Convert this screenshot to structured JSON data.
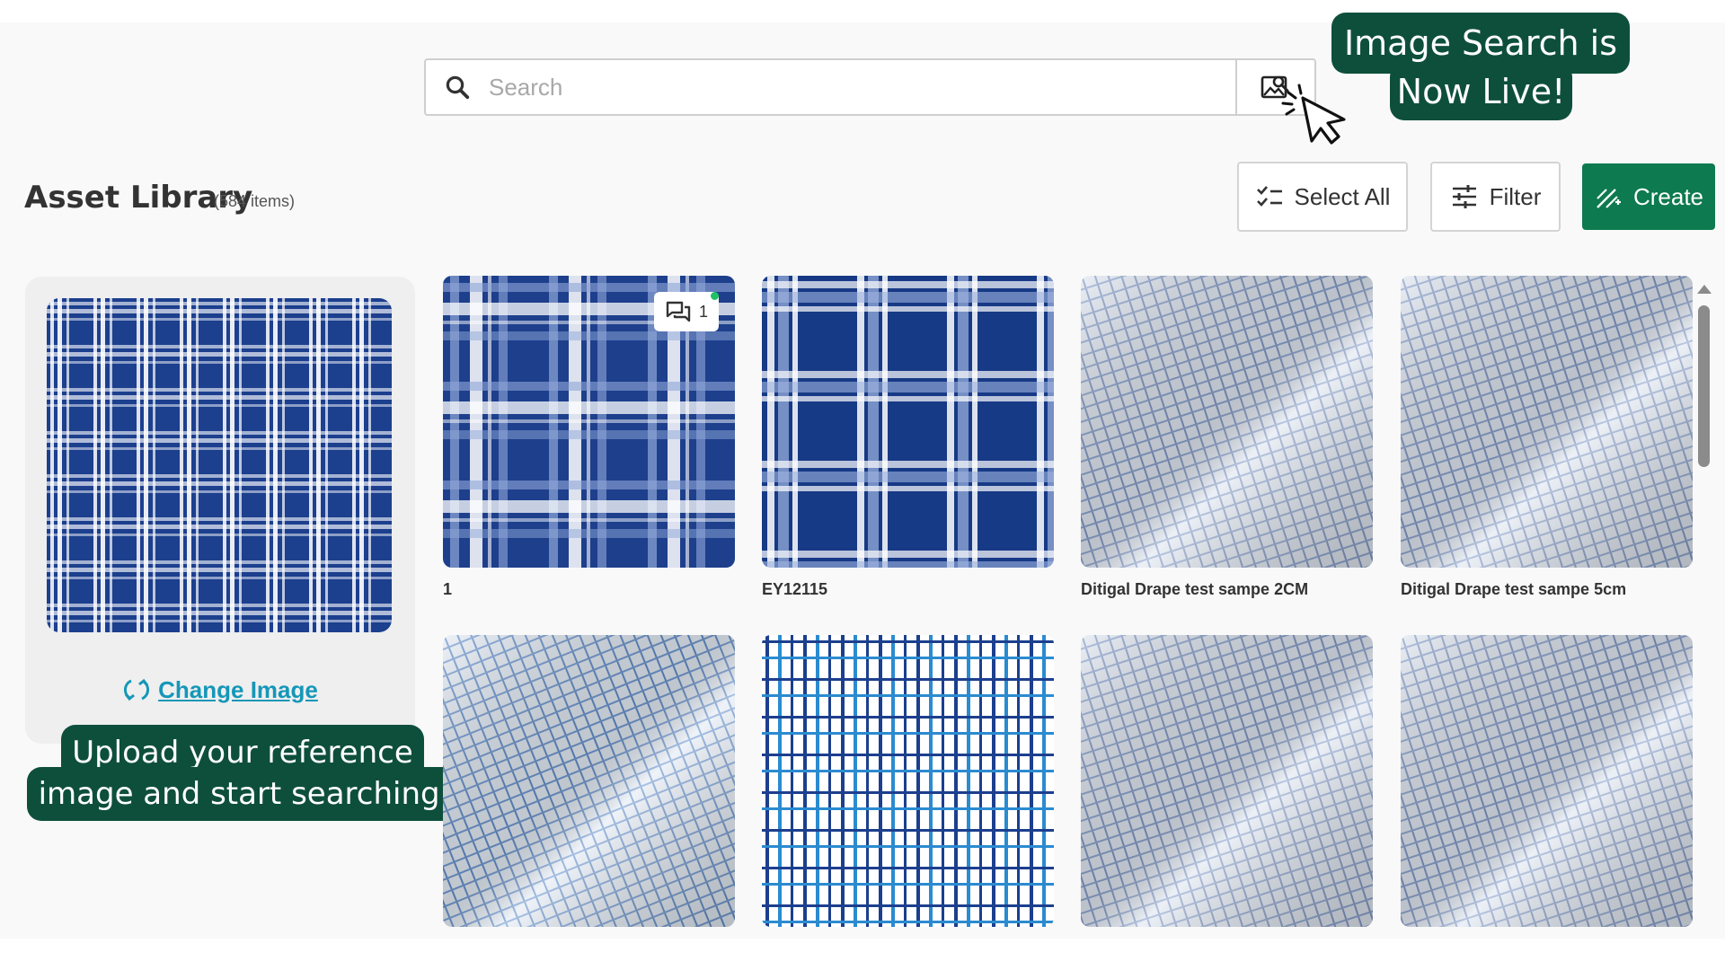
{
  "search": {
    "placeholder": "Search"
  },
  "callouts": {
    "top_line1": "Image Search is",
    "top_line2": "Now Live!",
    "bottom_line1": "Upload your reference",
    "bottom_line2": "image and start searching."
  },
  "header": {
    "title": "Asset Library",
    "item_count": "(584 items)",
    "select_all_label": "Select All",
    "filter_label": "Filter",
    "create_label": "Create"
  },
  "reference": {
    "change_image_label": "Change Image"
  },
  "assets": [
    {
      "name": "1",
      "comment_count": "1"
    },
    {
      "name": "EY12115"
    },
    {
      "name": "Ditigal Drape test sampe 2CM"
    },
    {
      "name": "Ditigal Drape test sampe 5cm"
    },
    {
      "name": ""
    },
    {
      "name": ""
    },
    {
      "name": ""
    },
    {
      "name": ""
    }
  ],
  "colors": {
    "brand_dark": "#0e4f3c",
    "create_green": "#0d7a4f",
    "link_blue": "#1597b8",
    "fabric_navy": "#1c3f8e"
  }
}
